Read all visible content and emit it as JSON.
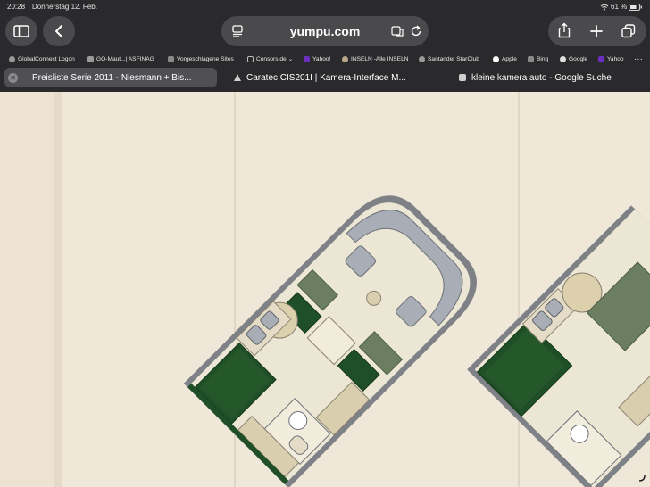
{
  "status": {
    "time": "20:28",
    "date": "Donnerstag 12. Feb.",
    "battery": "61 %"
  },
  "toolbar": {
    "url": "yumpu.com"
  },
  "icons": [
    "sidebar-icon",
    "back-icon",
    "reader-icon",
    "translate-icon",
    "reload-icon",
    "share-icon",
    "plus-icon",
    "tabs-icon",
    "close-icon"
  ],
  "favorites": [
    {
      "label": "GlobalConnect Logon",
      "color": "#9a9a9a"
    },
    {
      "label": "GO-Maut...| ASFINAG",
      "color": "#9a9a9a"
    },
    {
      "label": "Vorgeschlagene Sites",
      "color": "#8a8a8a"
    },
    {
      "label": "Consors.de",
      "color": "#8a8a8a"
    },
    {
      "label": "Yahoo!",
      "color": "#6b2fbf"
    },
    {
      "label": "INSELN -Alle INSELN",
      "color": "#b8a888"
    },
    {
      "label": "Santander StarClub",
      "color": "#9a9a9a"
    },
    {
      "label": "Apple",
      "color": "#ffffff"
    },
    {
      "label": "Bing",
      "color": "#8a8a8a"
    },
    {
      "label": "Google",
      "color": "#e0e0e0"
    },
    {
      "label": "Yahoo",
      "color": "#6b2fbf"
    }
  ],
  "tabs": [
    {
      "label": "Preisliste Serie 2011 - Niesmann + Bis..."
    },
    {
      "label": "Caratec CIS201I | Kamera-Interface M..."
    },
    {
      "label": "kleine kamera auto - Google Suche"
    }
  ]
}
